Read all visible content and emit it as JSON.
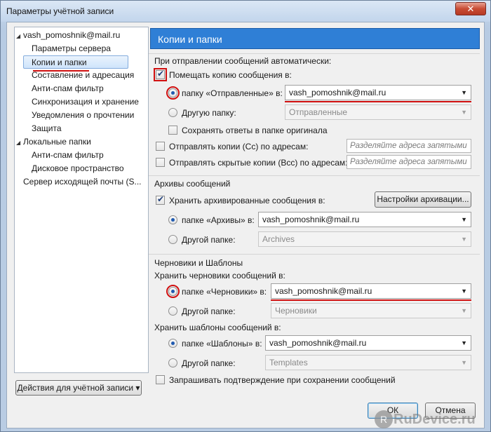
{
  "window": {
    "title": "Параметры учётной записи",
    "close": "✕"
  },
  "tree": {
    "items": [
      {
        "label": "vash_pomoshnik@mail.ru",
        "expand": "◢"
      },
      {
        "label": "Параметры сервера"
      },
      {
        "label": "Копии и папки"
      },
      {
        "label": "Составление и адресация"
      },
      {
        "label": "Анти-спам фильтр"
      },
      {
        "label": "Синхронизация и хранение"
      },
      {
        "label": "Уведомления о прочтении"
      },
      {
        "label": "Защита"
      },
      {
        "label": "Локальные папки",
        "expand": "◢"
      },
      {
        "label": "Анти-спам фильтр"
      },
      {
        "label": "Дисковое пространство"
      },
      {
        "label": "Сервер исходящей почты (S..."
      }
    ],
    "actions_button": "Действия для учётной записи ▾"
  },
  "panel": {
    "title": "Копии и папки"
  },
  "sending": {
    "heading": "При отправлении сообщений автоматически:",
    "place_copy_label": "Помещать копию сообщения в:",
    "place_copy_checked": true,
    "sent_folder_label": "папку «Отправленные» в:",
    "sent_folder_value": "vash_pomoshnik@mail.ru",
    "other_folder_label": "Другую папку:",
    "other_folder_value": "Отправленные",
    "keep_replies_label": "Сохранять ответы в папке оригинала",
    "cc_label": "Отправлять копии (Cc) по адресам:",
    "cc_placeholder": "Разделяйте адреса запятыми",
    "bcc_label": "Отправлять скрытые копии (Bcc) по адресам:",
    "bcc_placeholder": "Разделяйте адреса запятыми"
  },
  "archives": {
    "heading": "Архивы сообщений",
    "keep_label": "Хранить архивированные сообщения в:",
    "settings_button": "Настройки архивации...",
    "archives_folder_label": "папке «Архивы» в:",
    "archives_folder_value": "vash_pomoshnik@mail.ru",
    "other_folder_label": "Другой папке:",
    "other_folder_value": "Archives"
  },
  "drafts": {
    "heading": "Черновики и Шаблоны",
    "drafts_heading": "Хранить черновики сообщений в:",
    "drafts_folder_label": "папке «Черновики» в:",
    "drafts_folder_value": "vash_pomoshnik@mail.ru",
    "drafts_other_label": "Другой папке:",
    "drafts_other_value": "Черновики",
    "templates_heading": "Хранить шаблоны сообщений в:",
    "templates_folder_label": "папке «Шаблоны» в:",
    "templates_folder_value": "vash_pomoshnik@mail.ru",
    "templates_other_label": "Другой папке:",
    "templates_other_value": "Templates",
    "confirm_label": "Запрашивать подтверждение при сохранении сообщений"
  },
  "buttons": {
    "ok": "ОК",
    "cancel": "Отмена"
  },
  "watermark": {
    "text": "RuDevice.ru",
    "icon": "R"
  },
  "colors": {
    "accent": "#2f7fd6",
    "highlight": "#d01010"
  }
}
